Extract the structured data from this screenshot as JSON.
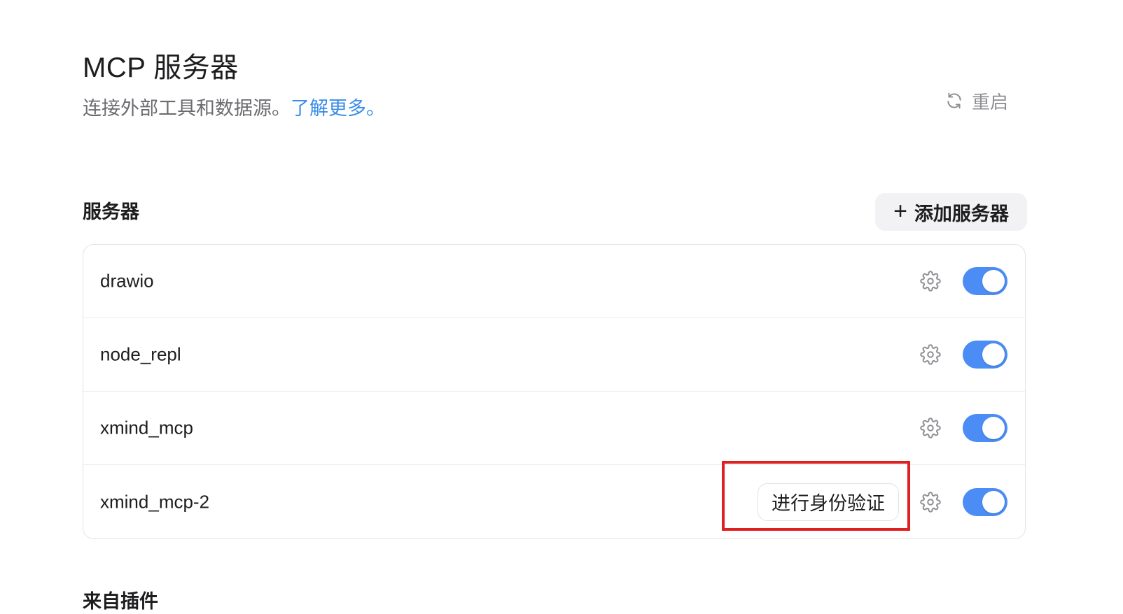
{
  "header": {
    "title": "MCP 服务器",
    "subtitle": "连接外部工具和数据源。",
    "learn_more": "了解更多。",
    "restart_label": "重启",
    "restart_icon": "refresh-icon"
  },
  "servers_section": {
    "title": "服务器",
    "add_button_label": "添加服务器",
    "add_button_icon": "plus-icon",
    "items": [
      {
        "name": "drawio",
        "enabled": true,
        "settings_icon": "gear-icon"
      },
      {
        "name": "node_repl",
        "enabled": true,
        "settings_icon": "gear-icon"
      },
      {
        "name": "xmind_mcp",
        "enabled": true,
        "settings_icon": "gear-icon"
      },
      {
        "name": "xmind_mcp-2",
        "enabled": true,
        "settings_icon": "gear-icon",
        "auth_button_label": "进行身份验证"
      }
    ]
  },
  "plugins_section": {
    "title": "来自插件"
  },
  "colors": {
    "accent": "#4b8df5",
    "link": "#3a8ce8",
    "highlight": "#e02020"
  }
}
